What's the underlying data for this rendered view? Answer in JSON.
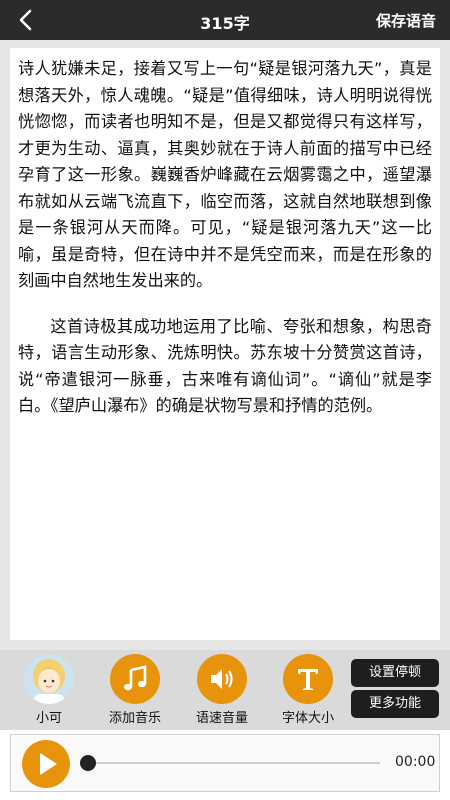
{
  "header": {
    "title": "315字",
    "save_label": "保存语音",
    "back_icon": "back-arrow-icon"
  },
  "content": {
    "paragraphs": [
      "诗人犹嫌未足，接着又写上一句“疑是银河落九天”，真是想落天外，惊人魂魄。“疑是”值得细味，诗人明明说得恍恍惚惚，而读者也明知不是，但是又都觉得只有这样写，才更为生动、逼真，其奥妙就在于诗人前面的描写中已经孕育了这一形象。巍巍香炉峰藏在云烟雾霭之中，遥望瀑布就如从云端飞流直下，临空而落，这就自然地联想到像是一条银河从天而降。可见，“疑是银河落九天”这一比喻，虽是奇特，但在诗中并不是凭空而来，而是在形象的刻画中自然地生发出来的。",
      "这首诗极其成功地运用了比喻、夸张和想象，构思奇特，语言生动形象、洗炼明快。苏东坡十分赞赏这首诗，说“帝遣银河一脉垂，古来唯有谪仙词”。“谪仙”就是李白。《望庐山瀑布》的确是状物写景和抒情的范例。"
    ]
  },
  "toolbar": {
    "voice_label": "小可",
    "music_label": "添加音乐",
    "speed_label": "语速音量",
    "font_label": "字体大小",
    "pause_settings_label": "设置停顿",
    "more_label": "更多功能",
    "accent_color": "#e8930c"
  },
  "player": {
    "time": "00:00",
    "progress": 0
  }
}
